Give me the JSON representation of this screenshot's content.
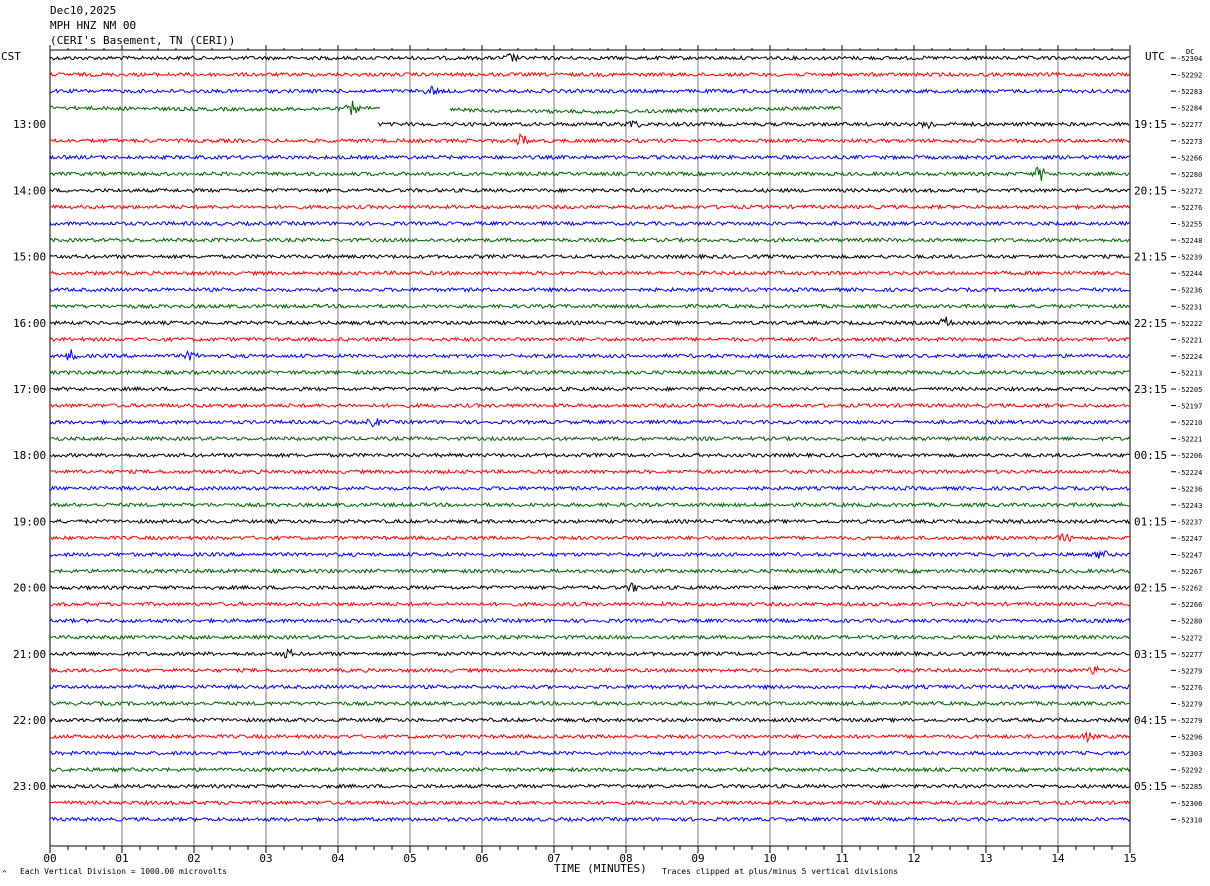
{
  "header": {
    "date": "Dec10,2025",
    "station": "MPH HNZ NM 00",
    "location": "(CERI's Basement, TN (CERI))"
  },
  "left_axis_title": "CST",
  "right_axis_title": "UTC",
  "dc_title": "DC",
  "footer": {
    "scale_note": "Each Vertical Division = 1000.00 microvolts",
    "xlabel": "TIME (MINUTES)",
    "clip_note": "Traces clipped at plus/minus 5 vertical divisions",
    "corner_mark": "^"
  },
  "colors": {
    "palette": [
      "#000000",
      "#ff0000",
      "#0000ff",
      "#006400"
    ],
    "grid": "#7f7f7f"
  },
  "chart_data": {
    "type": "line",
    "description_of_series": "helicorder traces, 47 rows of 15 minutes each",
    "xlim": [
      0,
      15
    ],
    "x_ticks": [
      "00",
      "01",
      "02",
      "03",
      "04",
      "05",
      "06",
      "07",
      "08",
      "09",
      "10",
      "11",
      "12",
      "13",
      "14",
      "15"
    ],
    "left_hour_labels": [
      "13:00",
      "14:00",
      "15:00",
      "16:00",
      "17:00",
      "18:00",
      "19:00",
      "20:00",
      "21:00",
      "22:00",
      "23:00"
    ],
    "right_hour_labels": [
      "19:15",
      "20:15",
      "21:15",
      "22:15",
      "23:15",
      "00:15",
      "01:15",
      "02:15",
      "03:15",
      "04:15",
      "05:15"
    ],
    "dc_offsets": [
      "-52304",
      "-52292",
      "-52283",
      "-52284",
      "-52277",
      "-52273",
      "-52266",
      "-52280",
      "-52272",
      "-52276",
      "-52255",
      "-52248",
      "-52239",
      "-52244",
      "-52236",
      "-52231",
      "-52222",
      "-52221",
      "-52224",
      "-52213",
      "-52205",
      "-52197",
      "-52210",
      "-52221",
      "-52206",
      "-52224",
      "-52236",
      "-52243",
      "-52237",
      "-52247",
      "-52247",
      "-52267",
      "-52262",
      "-52266",
      "-52280",
      "-52272",
      "-52277",
      "-52279",
      "-52276",
      "-52279",
      "-52279",
      "-52296",
      "-52303",
      "-52292",
      "-52285",
      "-52306",
      "-52310"
    ],
    "row_spans": [
      {
        "row": 0,
        "start": 0,
        "end": 15
      },
      {
        "row": 1,
        "start": 0,
        "end": 15
      },
      {
        "row": 2,
        "start": 0,
        "end": 15
      },
      {
        "row": 3,
        "start": 0,
        "end": 11,
        "gap": [
          4.6,
          5.55
        ]
      },
      {
        "row": 4,
        "start": 4.55,
        "end": 15
      }
    ],
    "bursts": [
      {
        "row": 0,
        "x": 6.4,
        "amp": 4
      },
      {
        "row": 2,
        "x": 5.3,
        "amp": 4
      },
      {
        "row": 3,
        "x": 4.2,
        "amp": 6
      },
      {
        "row": 4,
        "x": 8.1,
        "amp": 4
      },
      {
        "row": 4,
        "x": 12.2,
        "amp": 4
      },
      {
        "row": 5,
        "x": 6.55,
        "amp": 6
      },
      {
        "row": 7,
        "x": 13.75,
        "amp": 7
      },
      {
        "row": 16,
        "x": 12.45,
        "amp": 5
      },
      {
        "row": 18,
        "x": 0.3,
        "amp": 5
      },
      {
        "row": 18,
        "x": 1.95,
        "amp": 4
      },
      {
        "row": 22,
        "x": 4.5,
        "amp": 4
      },
      {
        "row": 30,
        "x": 14.6,
        "amp": 4
      },
      {
        "row": 32,
        "x": 8.1,
        "amp": 4
      },
      {
        "row": 36,
        "x": 3.3,
        "amp": 4
      },
      {
        "row": 37,
        "x": 14.5,
        "amp": 4
      },
      {
        "row": 41,
        "x": 14.4,
        "amp": 4
      },
      {
        "row": 29,
        "x": 14.1,
        "amp": 4
      }
    ],
    "noise_amp": 1.8
  }
}
